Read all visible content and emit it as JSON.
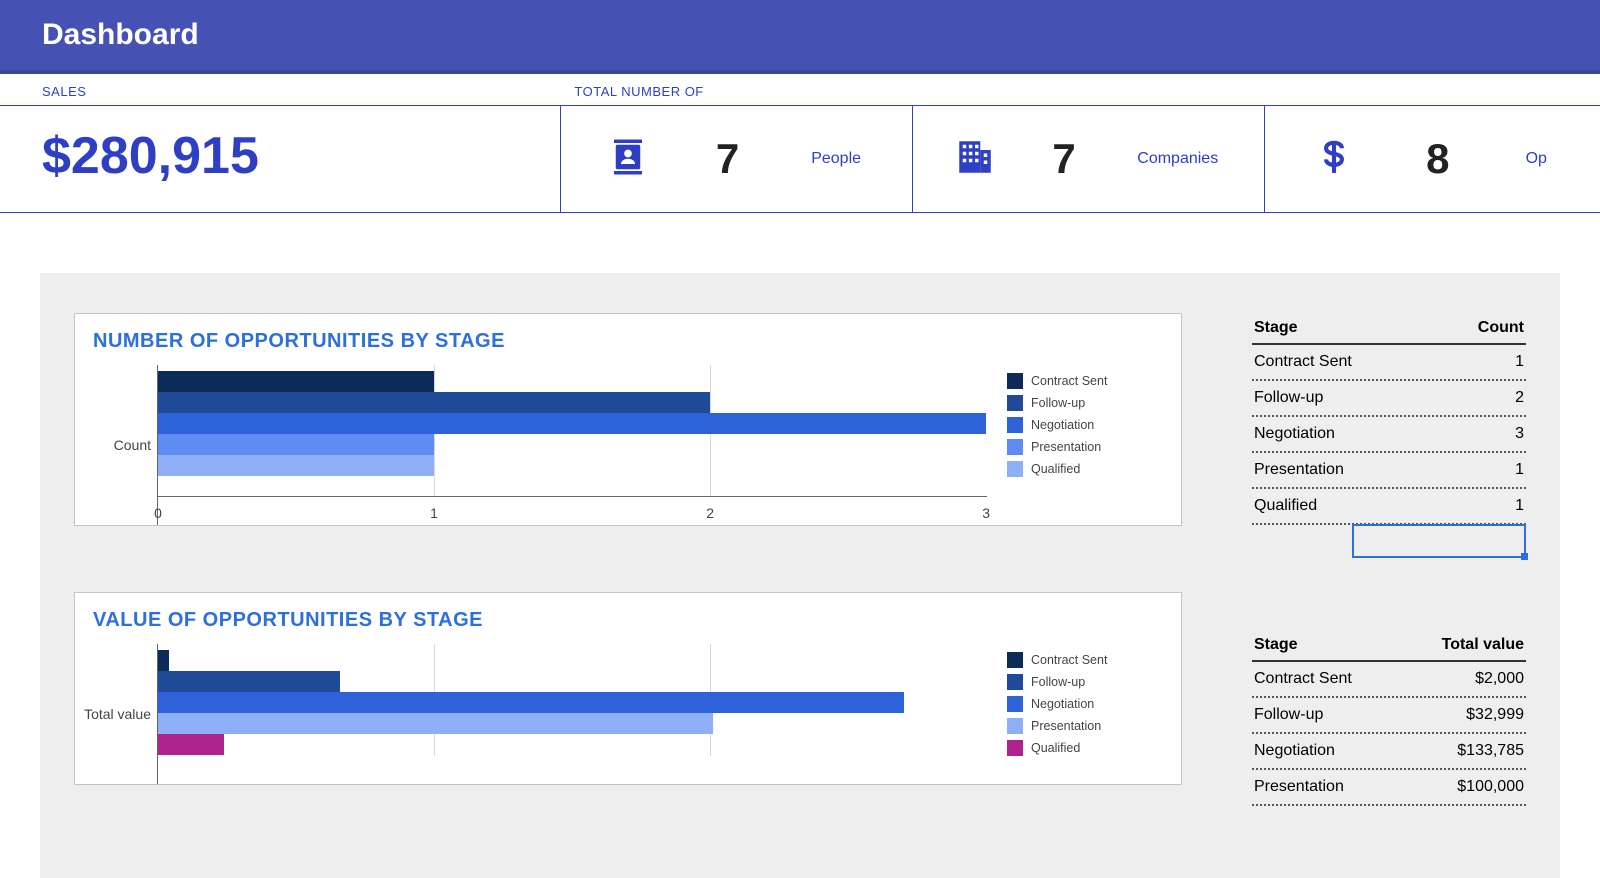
{
  "header": {
    "title": "Dashboard"
  },
  "topbar": {
    "sales_label": "SALES",
    "total_label": "TOTAL NUMBER OF",
    "sales_value": "$280,915",
    "metrics": [
      {
        "icon": "person",
        "value": "7",
        "label": "People"
      },
      {
        "icon": "building",
        "value": "7",
        "label": "Companies"
      },
      {
        "icon": "dollar",
        "value": "8",
        "label": "Op"
      }
    ]
  },
  "chart1": {
    "title": "NUMBER OF OPPORTUNITIES BY STAGE",
    "ylabel": "Count",
    "xticks": [
      "0",
      "1",
      "2",
      "3"
    ],
    "legend": [
      "Contract Sent",
      "Follow-up",
      "Negotiation",
      "Presentation",
      "Qualified"
    ]
  },
  "chart2": {
    "title": "VALUE OF OPPORTUNITIES BY STAGE",
    "ylabel": "Total value",
    "legend": [
      "Contract Sent",
      "Follow-up",
      "Negotiation",
      "Presentation",
      "Qualified"
    ]
  },
  "table1": {
    "head_left": "Stage",
    "head_right": "Count",
    "rows": [
      {
        "l": "Contract Sent",
        "r": "1"
      },
      {
        "l": "Follow-up",
        "r": "2"
      },
      {
        "l": "Negotiation",
        "r": "3"
      },
      {
        "l": "Presentation",
        "r": "1"
      },
      {
        "l": "Qualified",
        "r": "1"
      }
    ]
  },
  "table2": {
    "head_left": "Stage",
    "head_right": "Total value",
    "rows": [
      {
        "l": "Contract Sent",
        "r": "$2,000"
      },
      {
        "l": "Follow-up",
        "r": "$32,999"
      },
      {
        "l": "Negotiation",
        "r": "$133,785"
      },
      {
        "l": "Presentation",
        "r": "$100,000"
      }
    ]
  },
  "colors": {
    "s0": "#0c2b58",
    "s1": "#1f4a97",
    "s2": "#2e62d9",
    "s3": "#5f8cf0",
    "s4": "#8eaef6",
    "magenta": "#b0228c"
  },
  "chart_data": [
    {
      "type": "bar",
      "orientation": "horizontal",
      "title": "NUMBER OF OPPORTUNITIES BY STAGE",
      "ylabel": "Count",
      "xlim": [
        0,
        3
      ],
      "series": [
        {
          "name": "Contract Sent",
          "value": 1
        },
        {
          "name": "Follow-up",
          "value": 2
        },
        {
          "name": "Negotiation",
          "value": 3
        },
        {
          "name": "Presentation",
          "value": 1
        },
        {
          "name": "Qualified",
          "value": 1
        }
      ]
    },
    {
      "type": "bar",
      "orientation": "horizontal",
      "title": "VALUE OF OPPORTUNITIES BY STAGE",
      "ylabel": "Total value",
      "series": [
        {
          "name": "Contract Sent",
          "value": 2000
        },
        {
          "name": "Follow-up",
          "value": 32999
        },
        {
          "name": "Negotiation",
          "value": 133785
        },
        {
          "name": "Presentation",
          "value": 100000
        },
        {
          "name": "Qualified",
          "value": 12131
        }
      ]
    }
  ]
}
